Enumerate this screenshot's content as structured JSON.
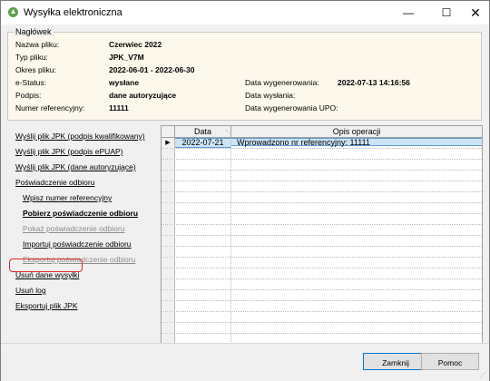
{
  "window": {
    "title": "Wysyłka elektroniczna",
    "title_icon": "leaf-icon"
  },
  "header": {
    "caption": "Nagłówek",
    "fields_left": [
      {
        "label": "Nazwa pliku:",
        "value": "Czerwiec 2022"
      },
      {
        "label": "Typ pliku:",
        "value": "JPK_V7M"
      },
      {
        "label": "Okres pliku:",
        "value": "2022-06-01 - 2022-06-30"
      },
      {
        "label": "e-Status:",
        "value": "wysłane"
      },
      {
        "label": "Podpis:",
        "value": "dane autoryzujące"
      },
      {
        "label": "Numer referencyjny:",
        "value": "11111"
      }
    ],
    "fields_right": [
      {
        "label": "Data wygenerowania:",
        "value": "2022-07-13 14:16:56"
      },
      {
        "label": "Data wysłania:",
        "value": ""
      },
      {
        "label": "Data wygenerowania UPO:",
        "value": ""
      }
    ]
  },
  "actions": [
    {
      "label": "Wyślij plik JPK (podpis kwalifikowany)",
      "state": "normal"
    },
    {
      "label": "Wyślij plik JPK (podpis ePUAP)",
      "state": "normal"
    },
    {
      "label": "Wyślij plik JPK (dane autoryzujące)",
      "state": "normal"
    },
    {
      "label": "Poświadczenie odbioru",
      "state": "normal"
    },
    {
      "label": "Wpisz numer referencyjny",
      "state": "normal"
    },
    {
      "label": "Pobierz poświadczenie odbioru",
      "state": "bold"
    },
    {
      "label": "Pokaż poświadczenie odbioru",
      "state": "disabled"
    },
    {
      "label": "Importuj poświadczenie odbioru",
      "state": "normal"
    },
    {
      "label": "Eksportuj poświadczenie odbioru",
      "state": "disabled"
    },
    {
      "label": "Usuń dane wysyłki",
      "state": "normal"
    },
    {
      "label": "Usuń log",
      "state": "normal"
    },
    {
      "label": "Eksportuj plik JPK",
      "state": "normal"
    }
  ],
  "grid": {
    "columns": [
      "Data",
      "Opis operacji"
    ],
    "rows": [
      {
        "indicator": "▶",
        "date": "2022-07-21",
        "description": "Wprowadzono nr referencyjny: 11111"
      }
    ],
    "empty_rows": 18
  },
  "buttons": {
    "close": "Zamknij",
    "help": "Pomoc"
  },
  "colors": {
    "header_bg": "#fdf8ec",
    "selection": "#cce4f7",
    "highlight": "#e02424"
  }
}
